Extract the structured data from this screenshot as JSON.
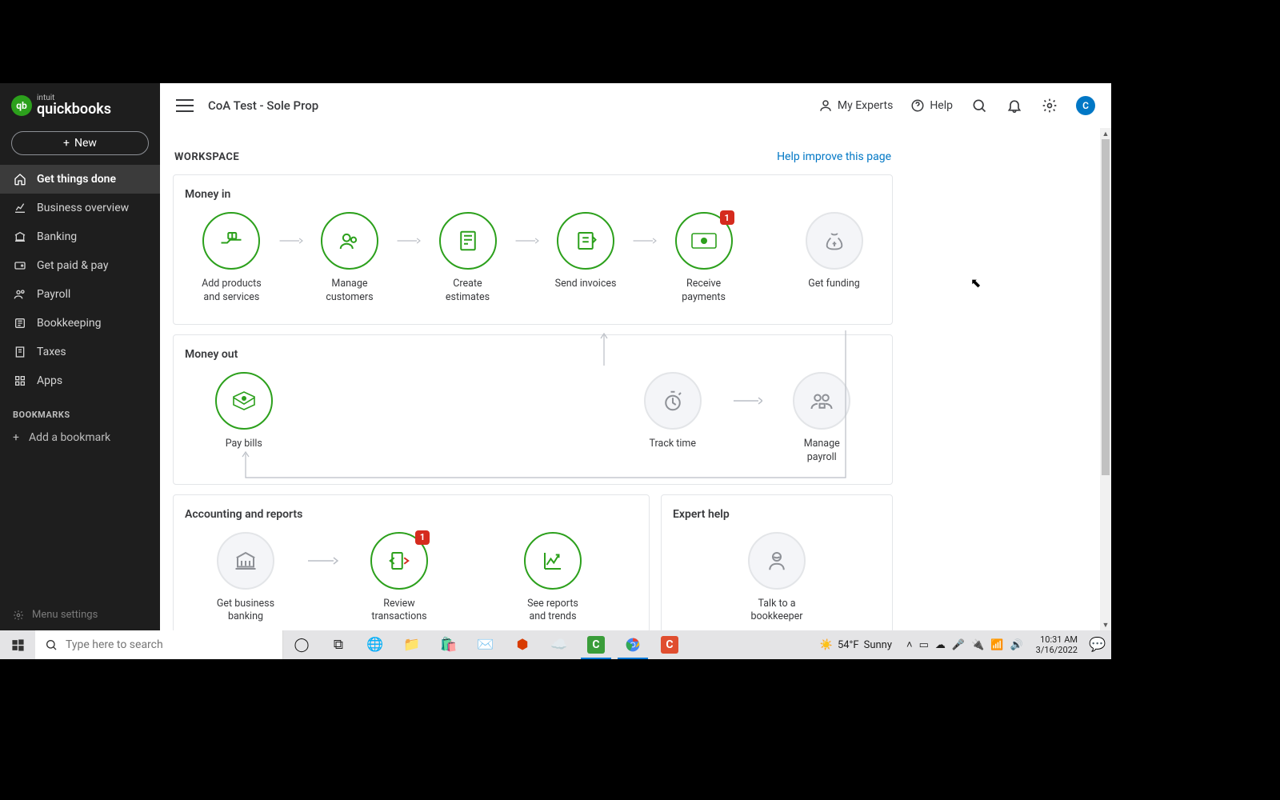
{
  "brand": {
    "intuit": "intuit",
    "name": "quickbooks",
    "badge": "qb"
  },
  "new_button": "New",
  "sidebar": {
    "items": [
      {
        "label": "Get things done",
        "active": true
      },
      {
        "label": "Business overview"
      },
      {
        "label": "Banking"
      },
      {
        "label": "Get paid & pay"
      },
      {
        "label": "Payroll"
      },
      {
        "label": "Bookkeeping"
      },
      {
        "label": "Taxes"
      },
      {
        "label": "Apps"
      }
    ],
    "bookmarks_header": "BOOKMARKS",
    "add_bookmark": "Add a bookmark",
    "menu_settings": "Menu settings"
  },
  "topbar": {
    "company": "CoA Test - Sole Prop",
    "my_experts": "My Experts",
    "help": "Help",
    "avatar_initial": "C"
  },
  "workspace": {
    "title": "WORKSPACE",
    "help_link": "Help improve this page",
    "money_in_title": "Money in",
    "money_out_title": "Money out",
    "accounting_title": "Accounting and reports",
    "expert_title": "Expert help",
    "tiles": {
      "add_products": {
        "l1": "Add products",
        "l2": "and services"
      },
      "manage_customers": {
        "l1": "Manage",
        "l2": "customers"
      },
      "create_estimates": {
        "l1": "Create",
        "l2": "estimates"
      },
      "send_invoices": "Send invoices",
      "receive_payments": {
        "l1": "Receive",
        "l2": "payments",
        "badge": "1"
      },
      "get_funding": "Get funding",
      "pay_bills": "Pay bills",
      "track_time": "Track time",
      "manage_payroll": {
        "l1": "Manage",
        "l2": "payroll"
      },
      "get_banking": {
        "l1": "Get business",
        "l2": "banking"
      },
      "review_transactions": {
        "l1": "Review",
        "l2": "transactions",
        "badge": "1"
      },
      "see_reports": {
        "l1": "See reports",
        "l2": "and trends"
      },
      "talk_bookkeeper": {
        "l1": "Talk to a",
        "l2": "bookkeeper"
      }
    }
  },
  "taskbar": {
    "search_placeholder": "Type here to search",
    "weather_temp": "54°F",
    "weather_desc": "Sunny",
    "time": "10:31 AM",
    "date": "3/16/2022"
  }
}
